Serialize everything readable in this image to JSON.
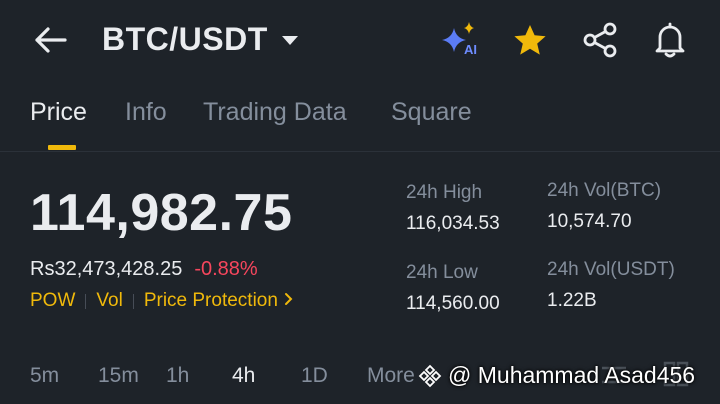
{
  "header": {
    "pair": "BTC/USDT",
    "icons": {
      "back": "arrow-left-icon",
      "ai": "ai-sparkle-icon",
      "favorite": "star-icon",
      "share": "share-icon",
      "alert": "bell-icon"
    },
    "ai_label": "AI"
  },
  "tabs": [
    {
      "label": "Price",
      "active": true
    },
    {
      "label": "Info",
      "active": false
    },
    {
      "label": "Trading Data",
      "active": false
    },
    {
      "label": "Square",
      "active": false
    }
  ],
  "price": {
    "last": "114,982.75",
    "fiat": "Rs32,473,428.25",
    "change": "-0.88%"
  },
  "tags": [
    "POW",
    "Vol",
    "Price Protection"
  ],
  "stats": {
    "high_label": "24h High",
    "high_value": "116,034.53",
    "low_label": "24h Low",
    "low_value": "114,560.00",
    "vol_btc_label": "24h Vol(BTC)",
    "vol_btc_value": "10,574.70",
    "vol_usdt_label": "24h Vol(USDT)",
    "vol_usdt_value": "1.22B"
  },
  "intervals": [
    {
      "label": "5m",
      "active": false
    },
    {
      "label": "15m",
      "active": false
    },
    {
      "label": "1h",
      "active": false
    },
    {
      "label": "4h",
      "active": true
    },
    {
      "label": "1D",
      "active": false
    },
    {
      "label": "More",
      "active": false
    }
  ],
  "watermark": "@ Muhammad Asad456",
  "colors": {
    "background": "#1e2329",
    "accent": "#f0b90b",
    "negative": "#f6465d",
    "muted": "#848e9c",
    "text": "#eaecef"
  }
}
